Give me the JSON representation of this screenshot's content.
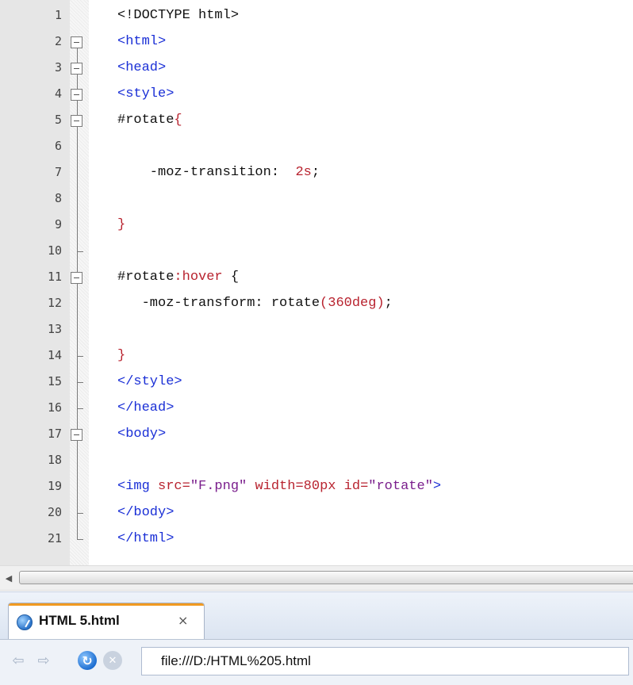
{
  "editor": {
    "line_numbers": [
      "1",
      "2",
      "3",
      "4",
      "5",
      "6",
      "7",
      "8",
      "9",
      "10",
      "11",
      "12",
      "13",
      "14",
      "15",
      "16",
      "17",
      "18",
      "19",
      "20",
      "21"
    ],
    "lines": [
      [
        {
          "t": "<!DOCTYPE html>",
          "c": "plain"
        }
      ],
      [
        {
          "t": "<html>",
          "c": "tag"
        }
      ],
      [
        {
          "t": "<head>",
          "c": "tag"
        }
      ],
      [
        {
          "t": "<style>",
          "c": "tag"
        }
      ],
      [
        {
          "t": "#rotate",
          "c": "plain"
        },
        {
          "t": "{",
          "c": "sel"
        }
      ],
      [],
      [
        {
          "t": "    -moz-transition:  ",
          "c": "plain"
        },
        {
          "t": "2s",
          "c": "num"
        },
        {
          "t": ";",
          "c": "plain"
        }
      ],
      [],
      [
        {
          "t": "}",
          "c": "sel"
        }
      ],
      [],
      [
        {
          "t": "#rotate",
          "c": "plain"
        },
        {
          "t": ":hover",
          "c": "sel"
        },
        {
          "t": " {",
          "c": "plain"
        }
      ],
      [
        {
          "t": "   -moz-transform: rotate",
          "c": "plain"
        },
        {
          "t": "(360deg)",
          "c": "num"
        },
        {
          "t": ";",
          "c": "plain"
        }
      ],
      [],
      [
        {
          "t": "}",
          "c": "sel"
        }
      ],
      [
        {
          "t": "</style>",
          "c": "tag"
        }
      ],
      [
        {
          "t": "</head>",
          "c": "tag"
        }
      ],
      [
        {
          "t": "<body>",
          "c": "tag"
        }
      ],
      [],
      [
        {
          "t": "<img ",
          "c": "tag"
        },
        {
          "t": "src=",
          "c": "attr"
        },
        {
          "t": "\"F.png\"",
          "c": "str"
        },
        {
          "t": " width=80px ",
          "c": "attr"
        },
        {
          "t": "id=",
          "c": "attr"
        },
        {
          "t": "\"rotate\"",
          "c": "str"
        },
        {
          "t": ">",
          "c": "tag"
        }
      ],
      [
        {
          "t": "</body>",
          "c": "tag"
        }
      ],
      [
        {
          "t": "</html>",
          "c": "tag"
        }
      ]
    ],
    "fold_boxes": [
      2,
      3,
      4,
      5,
      11,
      17
    ],
    "fold_ticks": [
      10,
      14,
      15,
      16,
      20
    ]
  },
  "browser": {
    "tab_title": "HTML 5.html",
    "tab_close": "×",
    "url": "file:///D:/HTML%205.html"
  }
}
